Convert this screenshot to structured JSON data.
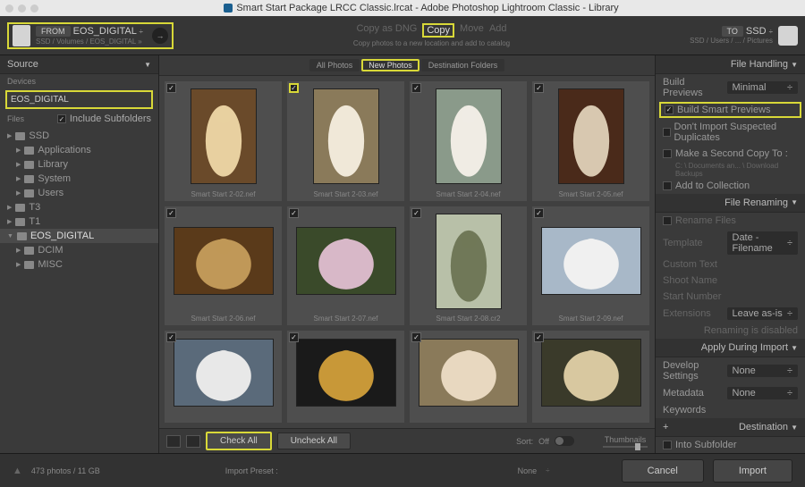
{
  "title": "Smart Start Package LRCC Classic.lrcat - Adobe Photoshop Lightroom Classic - Library",
  "topbar": {
    "from_label": "FROM",
    "from_device": "EOS_DIGITAL",
    "from_path": "SSD / Volumes / EOS_DIGITAL »",
    "modes": {
      "dng": "Copy as DNG",
      "copy": "Copy",
      "move": "Move",
      "add": "Add"
    },
    "mode_sub": "Copy photos to a new location and add to catalog",
    "to_label": "TO",
    "to_device": "SSD",
    "to_path": "SSD / Users / ... / Pictures"
  },
  "source": {
    "header": "Source",
    "devices_label": "Devices",
    "device": "EOS_DIGITAL",
    "files_label": "Files",
    "include_sub": "Include Subfolders",
    "tree": [
      {
        "l": 0,
        "t": "tri",
        "n": "SSD"
      },
      {
        "l": 1,
        "t": "fld",
        "n": "Applications"
      },
      {
        "l": 1,
        "t": "fld",
        "n": "Library"
      },
      {
        "l": 1,
        "t": "fld",
        "n": "System"
      },
      {
        "l": 1,
        "t": "fld",
        "n": "Users"
      },
      {
        "l": 0,
        "t": "tri",
        "n": "T3"
      },
      {
        "l": 0,
        "t": "tri",
        "n": "T1"
      },
      {
        "l": 0,
        "t": "tri",
        "n": "EOS_DIGITAL",
        "sel": true,
        "open": true
      },
      {
        "l": 1,
        "t": "fld",
        "n": "DCIM"
      },
      {
        "l": 1,
        "t": "fld",
        "n": "MISC"
      }
    ]
  },
  "filters": {
    "all": "All Photos",
    "new": "New Photos",
    "dest": "Destination Folders"
  },
  "thumbs": [
    {
      "cap": "Smart Start 2-02.nef",
      "o": "p",
      "bg": "#6a4a2a",
      "fg": "#e8d0a0"
    },
    {
      "cap": "Smart Start 2-03.nef",
      "o": "p",
      "bg": "#8a7a5a",
      "fg": "#f0e8d8",
      "hl": true
    },
    {
      "cap": "Smart Start 2-04.nef",
      "o": "p",
      "bg": "#8a9a8a",
      "fg": "#f0ece4"
    },
    {
      "cap": "Smart Start 2-05.nef",
      "o": "p",
      "bg": "#4a2a1a",
      "fg": "#d8c8b0"
    },
    {
      "cap": "Smart Start 2-06.nef",
      "o": "l",
      "bg": "#5a3a1a",
      "fg": "#c09858"
    },
    {
      "cap": "Smart Start 2-07.nef",
      "o": "l",
      "bg": "#3a4a2a",
      "fg": "#d8b8c8"
    },
    {
      "cap": "Smart Start 2-08.cr2",
      "o": "p",
      "bg": "#b8c0a8",
      "fg": "#707858"
    },
    {
      "cap": "Smart Start 2-09.nef",
      "o": "l",
      "bg": "#a8b8c8",
      "fg": "#f0f0f0"
    },
    {
      "cap": "",
      "o": "l",
      "bg": "#5a6a7a",
      "fg": "#e8e8e8"
    },
    {
      "cap": "",
      "o": "l",
      "bg": "#1a1a1a",
      "fg": "#c89838"
    },
    {
      "cap": "",
      "o": "l",
      "bg": "#8a7a5a",
      "fg": "#e8d8c0"
    },
    {
      "cap": "",
      "o": "l",
      "bg": "#3a3a2a",
      "fg": "#d8c8a0"
    }
  ],
  "footer": {
    "check_all": "Check All",
    "uncheck_all": "Uncheck All",
    "sort_label": "Sort:",
    "sort_value": "Off",
    "thumb_label": "Thumbnails"
  },
  "right": {
    "fh": {
      "header": "File Handling",
      "build_previews": "Build Previews",
      "build_previews_val": "Minimal",
      "smart": "Build Smart Previews",
      "nodup": "Don't Import Suspected Duplicates",
      "second": "Make a Second Copy To :",
      "second_path": "C: \\ Documents an... \\ Download Backups",
      "addcoll": "Add to Collection"
    },
    "fr": {
      "header": "File Renaming",
      "rename": "Rename Files",
      "template": "Template",
      "template_val": "Date - Filename",
      "custom": "Custom Text",
      "shoot": "Shoot Name",
      "startnum": "Start Number",
      "ext": "Extensions",
      "ext_val": "Leave as-is",
      "disabled": "Renaming is disabled"
    },
    "ad": {
      "header": "Apply During Import",
      "dev": "Develop Settings",
      "dev_val": "None",
      "meta": "Metadata",
      "meta_val": "None",
      "kw": "Keywords"
    },
    "dest": {
      "header": "Destination",
      "into": "Into Subfolder"
    }
  },
  "bottom": {
    "stats": "473 photos / 11 GB",
    "preset_label": "Import Preset :",
    "preset_val": "None",
    "cancel": "Cancel",
    "import": "Import"
  }
}
